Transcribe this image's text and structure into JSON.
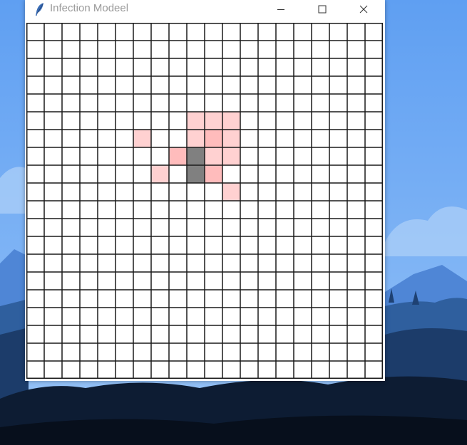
{
  "window": {
    "title": "Infection Modeel"
  },
  "icons": {
    "app": "feather-icon",
    "minimize": "minimize-icon",
    "maximize": "maximize-icon",
    "close": "close-icon"
  },
  "grid": {
    "rows": 20,
    "cols": 20,
    "colors": {
      "healthy": "#ffffff",
      "exposed": "#ffd1d1",
      "infected": "#ffbcbc",
      "dead": "#808080",
      "line": "#1a1a1a"
    },
    "cells": [
      {
        "row": 5,
        "col": 9,
        "state": "exposed"
      },
      {
        "row": 5,
        "col": 10,
        "state": "exposed"
      },
      {
        "row": 5,
        "col": 11,
        "state": "exposed"
      },
      {
        "row": 6,
        "col": 6,
        "state": "exposed"
      },
      {
        "row": 6,
        "col": 9,
        "state": "exposed"
      },
      {
        "row": 6,
        "col": 10,
        "state": "infected"
      },
      {
        "row": 6,
        "col": 11,
        "state": "exposed"
      },
      {
        "row": 7,
        "col": 8,
        "state": "infected"
      },
      {
        "row": 7,
        "col": 9,
        "state": "dead"
      },
      {
        "row": 7,
        "col": 10,
        "state": "exposed"
      },
      {
        "row": 7,
        "col": 11,
        "state": "exposed"
      },
      {
        "row": 8,
        "col": 7,
        "state": "exposed"
      },
      {
        "row": 8,
        "col": 9,
        "state": "dead"
      },
      {
        "row": 8,
        "col": 10,
        "state": "infected"
      },
      {
        "row": 9,
        "col": 11,
        "state": "exposed"
      }
    ]
  }
}
